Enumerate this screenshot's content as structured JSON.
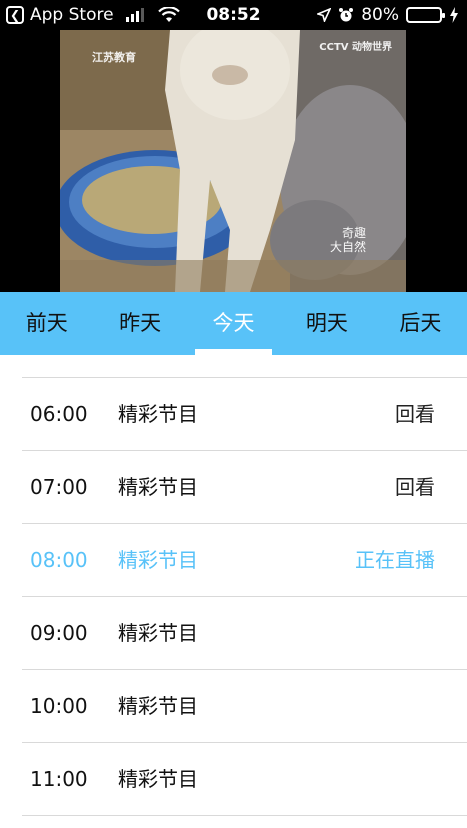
{
  "status_bar": {
    "back_app": "App Store",
    "time": "08:52",
    "battery_percent": "80%",
    "battery_level": 0.8,
    "accent": "#4cd964"
  },
  "video": {
    "watermark_left": "江苏教育",
    "watermark_right": "CCTV 动物世界",
    "watermark_bottom_line1": "奇趣",
    "watermark_bottom_line2": "大自然"
  },
  "tabs": {
    "items": [
      "前天",
      "昨天",
      "今天",
      "明天",
      "后天"
    ],
    "active_index": 2,
    "accent": "#58c2f8"
  },
  "schedule": [
    {
      "time": "06:00",
      "title": "精彩节目",
      "action": "回看",
      "live": false
    },
    {
      "time": "07:00",
      "title": "精彩节目",
      "action": "回看",
      "live": false
    },
    {
      "time": "08:00",
      "title": "精彩节目",
      "action": "正在直播",
      "live": true
    },
    {
      "time": "09:00",
      "title": "精彩节目",
      "action": "",
      "live": false
    },
    {
      "time": "10:00",
      "title": "精彩节目",
      "action": "",
      "live": false
    },
    {
      "time": "11:00",
      "title": "精彩节目",
      "action": "",
      "live": false
    }
  ]
}
